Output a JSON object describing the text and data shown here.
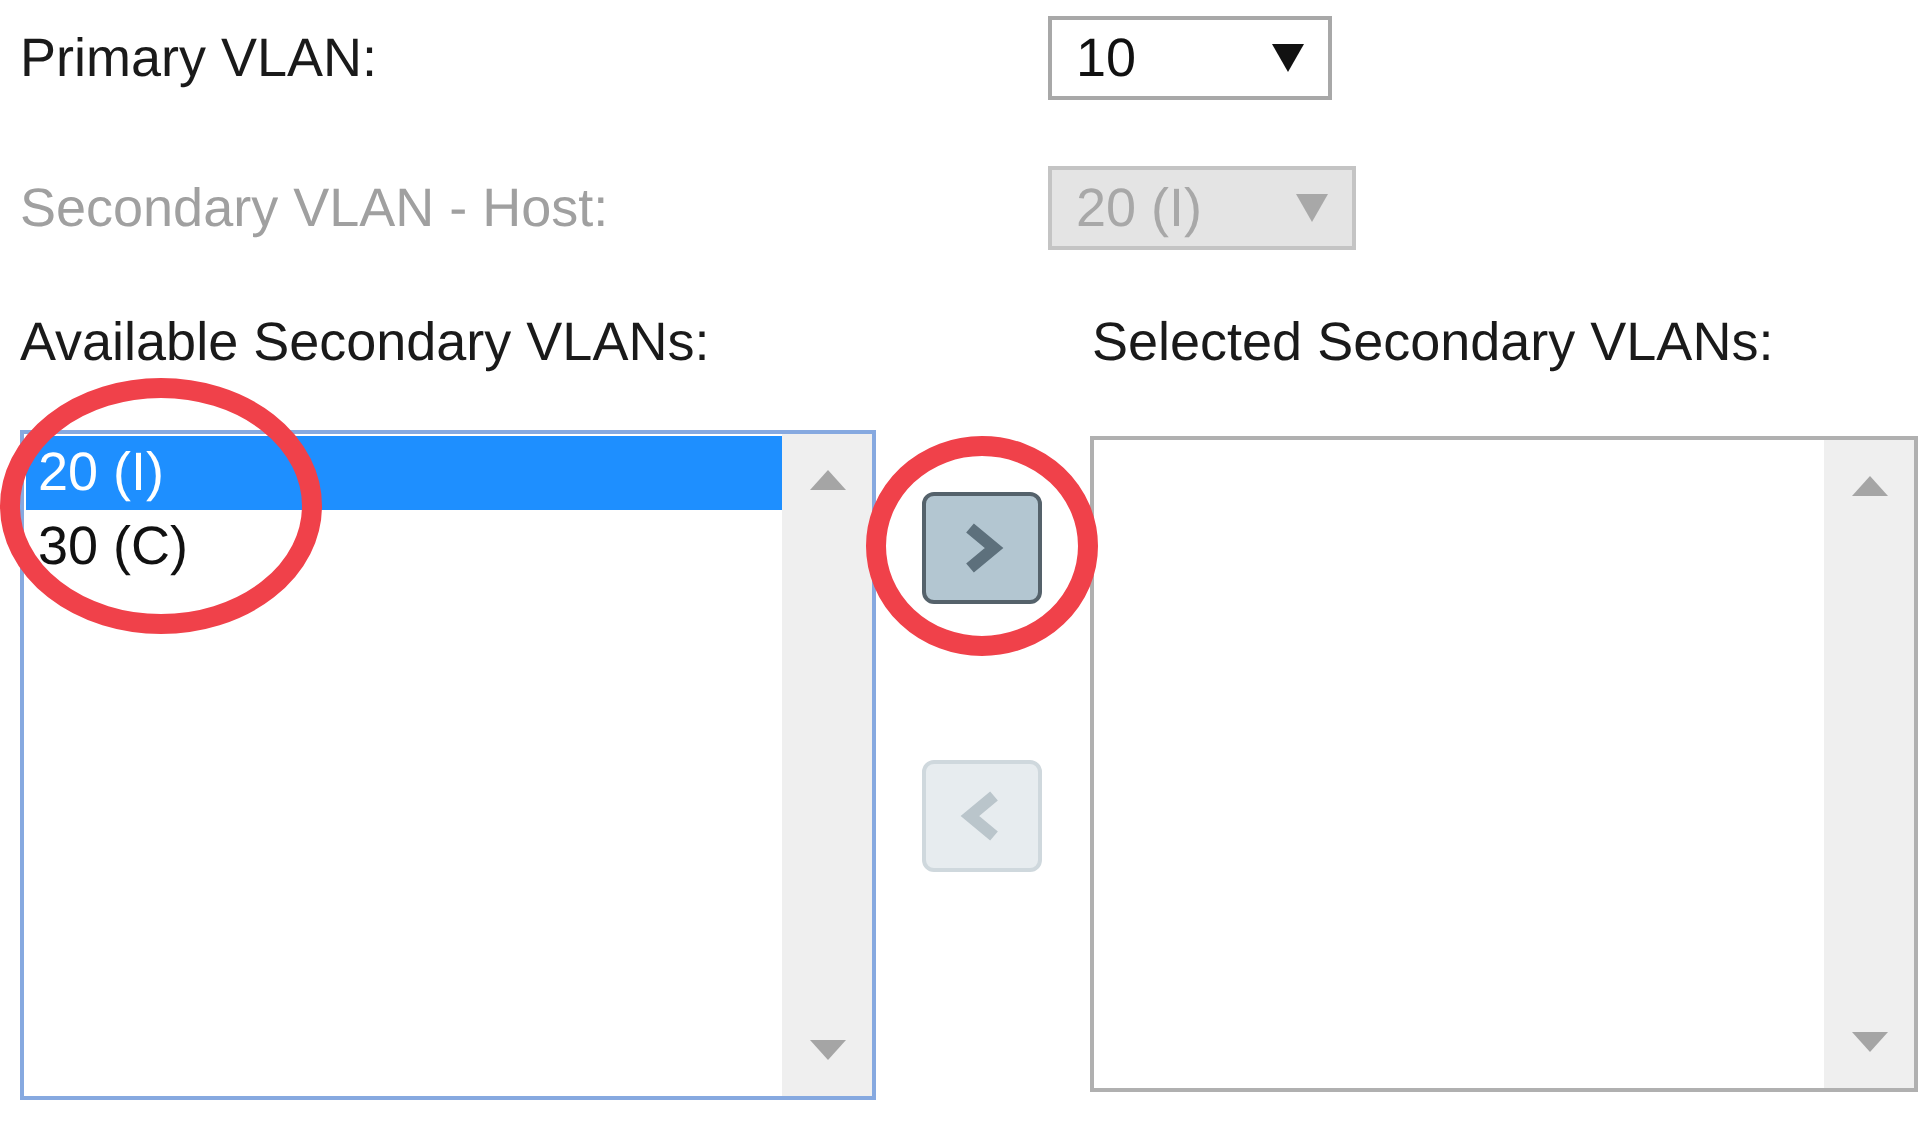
{
  "fields": [
    {
      "label": "Primary VLAN:",
      "value": "10",
      "disabled": false
    },
    {
      "label": "Secondary VLAN - Host:",
      "value": "20 (I)",
      "disabled": true
    }
  ],
  "available_list": {
    "label": "Available Secondary VLANs:",
    "highlighted": true,
    "items": [
      {
        "text": "20 (I)",
        "selected": true
      },
      {
        "text": "30 (C)",
        "selected": false
      }
    ]
  },
  "move_buttons": [
    {
      "kind": "right",
      "disabled": false,
      "highlighted": true
    },
    {
      "kind": "left",
      "disabled": true,
      "highlighted": false
    }
  ],
  "selected_list": {
    "label": "Selected Secondary VLANs:"
  }
}
